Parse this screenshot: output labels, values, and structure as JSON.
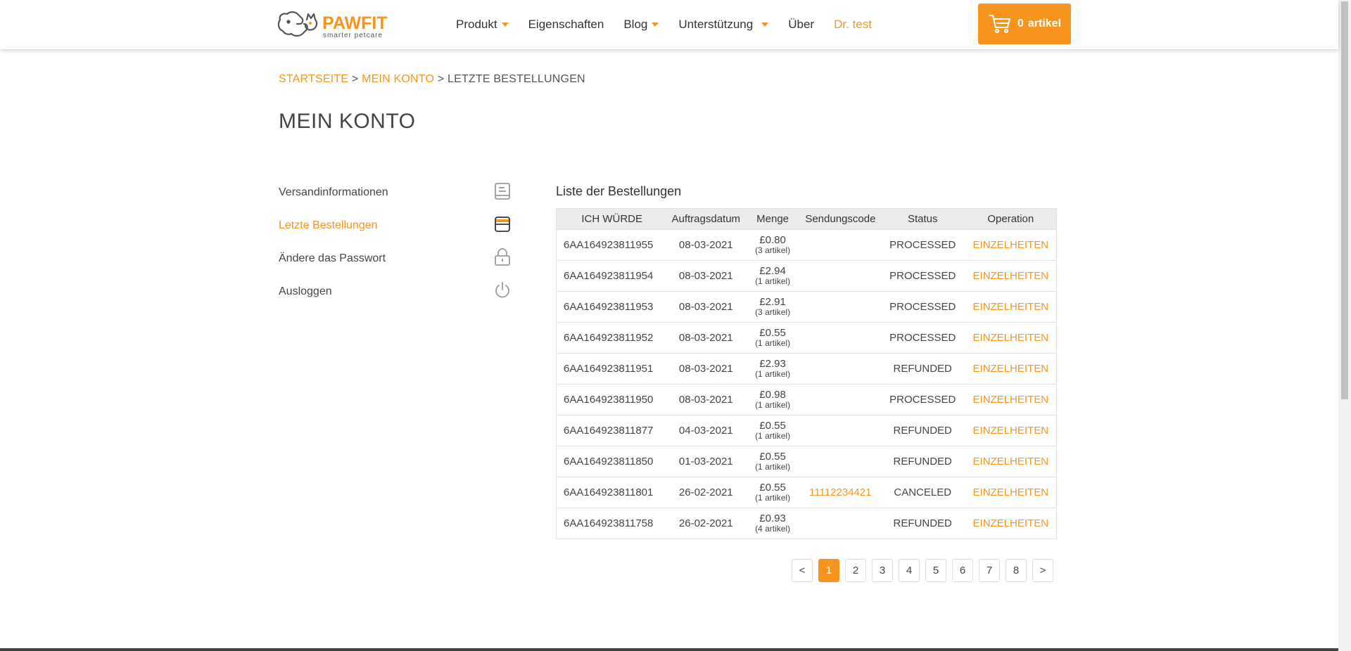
{
  "header": {
    "logo_text": "PAWFIT",
    "logo_tagline": "smarter petcare",
    "nav": [
      {
        "label": "Produkt",
        "dropdown": true
      },
      {
        "label": "Eigenschaften",
        "dropdown": false
      },
      {
        "label": "Blog",
        "dropdown": true
      },
      {
        "label": "Unterstützung",
        "dropdown": true
      },
      {
        "label": "Über",
        "dropdown": false
      },
      {
        "label": "Dr. test",
        "dropdown": false
      }
    ],
    "cart_count": "0",
    "cart_label": "artikel"
  },
  "breadcrumb": {
    "home": "STARTSEITE",
    "account": "MEIN KONTO",
    "current": "LETZTE BESTELLUNGEN",
    "separator": ">"
  },
  "page_title": "MEIN KONTO",
  "sidebar": {
    "items": [
      {
        "label": "Versandinformationen",
        "icon": "receipt-icon"
      },
      {
        "label": "Letzte Bestellungen",
        "icon": "orders-icon"
      },
      {
        "label": "Ändere das Passwort",
        "icon": "lock-icon"
      },
      {
        "label": "Ausloggen",
        "icon": "power-icon"
      }
    ]
  },
  "orders": {
    "heading": "Liste der Bestellungen",
    "columns": [
      "ICH WÜRDE",
      "Auftragsdatum",
      "Menge",
      "Sendungscode",
      "Status",
      "Operation"
    ],
    "rows": [
      {
        "id": "6AA164923811955",
        "date": "08-03-2021",
        "amount": "£0.80",
        "items": "(3 artikel)",
        "code": "",
        "status": "PROCESSED",
        "op": "EINZELHEITEN"
      },
      {
        "id": "6AA164923811954",
        "date": "08-03-2021",
        "amount": "£2.94",
        "items": "(1 artikel)",
        "code": "",
        "status": "PROCESSED",
        "op": "EINZELHEITEN"
      },
      {
        "id": "6AA164923811953",
        "date": "08-03-2021",
        "amount": "£2.91",
        "items": "(3 artikel)",
        "code": "",
        "status": "PROCESSED",
        "op": "EINZELHEITEN"
      },
      {
        "id": "6AA164923811952",
        "date": "08-03-2021",
        "amount": "£0.55",
        "items": "(1 artikel)",
        "code": "",
        "status": "PROCESSED",
        "op": "EINZELHEITEN"
      },
      {
        "id": "6AA164923811951",
        "date": "08-03-2021",
        "amount": "£2.93",
        "items": "(1 artikel)",
        "code": "",
        "status": "REFUNDED",
        "op": "EINZELHEITEN"
      },
      {
        "id": "6AA164923811950",
        "date": "08-03-2021",
        "amount": "£0.98",
        "items": "(1 artikel)",
        "code": "",
        "status": "PROCESSED",
        "op": "EINZELHEITEN"
      },
      {
        "id": "6AA164923811877",
        "date": "04-03-2021",
        "amount": "£0.55",
        "items": "(1 artikel)",
        "code": "",
        "status": "REFUNDED",
        "op": "EINZELHEITEN"
      },
      {
        "id": "6AA164923811850",
        "date": "01-03-2021",
        "amount": "£0.55",
        "items": "(1 artikel)",
        "code": "",
        "status": "REFUNDED",
        "op": "EINZELHEITEN"
      },
      {
        "id": "6AA164923811801",
        "date": "26-02-2021",
        "amount": "£0.55",
        "items": "(1 artikel)",
        "code": "11112234421",
        "status": "CANCELED",
        "op": "EINZELHEITEN"
      },
      {
        "id": "6AA164923811758",
        "date": "26-02-2021",
        "amount": "£0.93",
        "items": "(4 artikel)",
        "code": "",
        "status": "REFUNDED",
        "op": "EINZELHEITEN"
      }
    ]
  },
  "pagination": {
    "prev": "<",
    "next": ">",
    "pages": [
      "1",
      "2",
      "3",
      "4",
      "5",
      "6",
      "7",
      "8"
    ],
    "current": "1"
  },
  "colors": {
    "accent": "#f7941d",
    "text": "#444444",
    "table_header_bg": "#ececec"
  }
}
